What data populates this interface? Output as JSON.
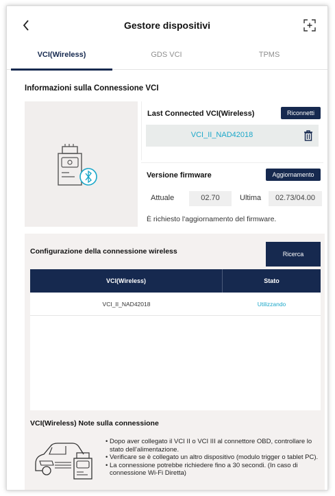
{
  "header": {
    "title": "Gestore dispositivi",
    "back_glyph": "<"
  },
  "tabs": [
    {
      "label": "VCI(Wireless)",
      "active": true
    },
    {
      "label": "GDS VCI",
      "active": false
    },
    {
      "label": "TPMS",
      "active": false
    }
  ],
  "connection_info": {
    "title": "Informazioni sulla Connessione VCI",
    "last_connected": {
      "title": "Last Connected VCI(Wireless)",
      "reconnect_label": "Riconnetti",
      "vci_name": "VCI_II_NAD42018"
    },
    "firmware": {
      "title": "Versione firmware",
      "update_label": "Aggiornamento",
      "current_label": "Attuale",
      "current_value": "02.70",
      "latest_label": "Ultima",
      "latest_value": "02.73/04.00",
      "note": "È richiesto l'aggiornamento del firmware."
    }
  },
  "wireless_config": {
    "title": "Configurazione della connessione wireless",
    "search_label": "Ricerca",
    "columns": [
      "VCI(Wireless)",
      "Stato"
    ],
    "rows": [
      {
        "vci": "VCI_II_NAD42018",
        "status": "Utilizzando"
      }
    ]
  },
  "notes": {
    "title": "VCI(Wireless) Note sulla connessione",
    "items": [
      "Dopo aver collegato il VCI II o VCI III al connettore OBD, controllare lo stato dell'alimentazione.",
      "Verificare se è collegato un altro dispositivo (modulo trigger o tablet PC).",
      "La connessione potrebbe richiedere fino a 30 secondi. (In caso di connessione Wi-Fi Diretta)"
    ]
  },
  "colors": {
    "navy": "#16294f",
    "accent_cyan": "#1aa7c9",
    "panel_bg": "#f1eeed"
  },
  "icons": [
    "back-icon",
    "expand-icon",
    "vci-bluetooth-icon",
    "trash-icon",
    "car-obd-icon"
  ]
}
